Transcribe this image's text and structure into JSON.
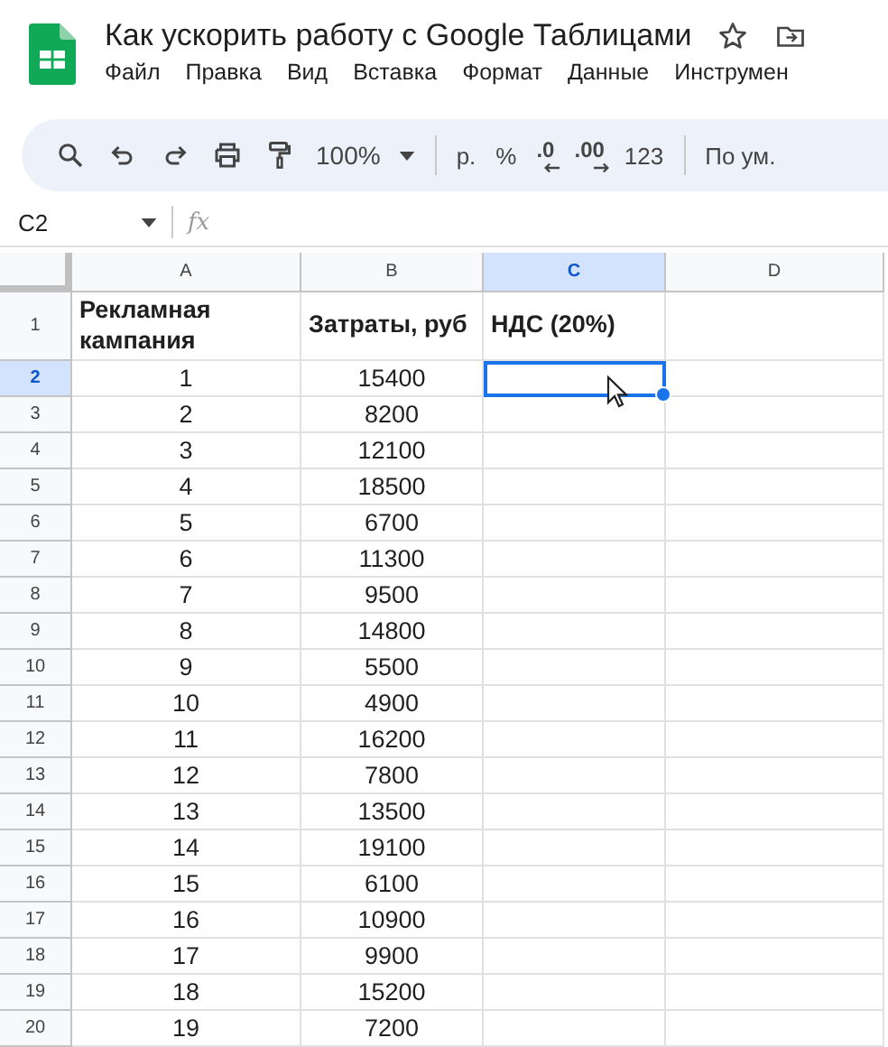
{
  "document": {
    "title": "Как ускорить работу с Google Таблицами",
    "starred": false
  },
  "menu": [
    "Файл",
    "Правка",
    "Вид",
    "Вставка",
    "Формат",
    "Данные",
    "Инструмен"
  ],
  "toolbar": [
    {
      "kind": "search"
    },
    {
      "kind": "undo"
    },
    {
      "kind": "redo"
    },
    {
      "kind": "print"
    },
    {
      "kind": "paint-format"
    },
    {
      "kind": "dropdown",
      "label": "100%"
    },
    {
      "kind": "separator"
    },
    {
      "kind": "text",
      "label": "р."
    },
    {
      "kind": "text",
      "label": "%"
    },
    {
      "kind": "decimal-less",
      "label": ".0"
    },
    {
      "kind": "decimal-more",
      "label": ".00"
    },
    {
      "kind": "text",
      "label": "123"
    },
    {
      "kind": "separator"
    },
    {
      "kind": "text",
      "label": "По ум."
    }
  ],
  "formula_bar": {
    "cell_ref": "C2",
    "fx_label": "fx"
  },
  "columns": [
    {
      "label": "A",
      "selected": false
    },
    {
      "label": "B",
      "selected": false
    },
    {
      "label": "C",
      "selected": true
    },
    {
      "label": "D",
      "selected": false
    }
  ],
  "rows": [
    {
      "number": "1",
      "selected": false,
      "header": true,
      "a": "Рекламная кампания",
      "b": "Затраты, руб",
      "c": "НДС (20%)"
    },
    {
      "number": "2",
      "selected": true,
      "a": "1",
      "b": "15400"
    },
    {
      "number": "3",
      "selected": false,
      "a": "2",
      "b": "8200"
    },
    {
      "number": "4",
      "selected": false,
      "a": "3",
      "b": "12100"
    },
    {
      "number": "5",
      "selected": false,
      "a": "4",
      "b": "18500"
    },
    {
      "number": "6",
      "selected": false,
      "a": "5",
      "b": "6700"
    },
    {
      "number": "7",
      "selected": false,
      "a": "6",
      "b": "11300"
    },
    {
      "number": "8",
      "selected": false,
      "a": "7",
      "b": "9500"
    },
    {
      "number": "9",
      "selected": false,
      "a": "8",
      "b": "14800"
    },
    {
      "number": "10",
      "selected": false,
      "a": "9",
      "b": "5500"
    },
    {
      "number": "11",
      "selected": false,
      "a": "10",
      "b": "4900"
    },
    {
      "number": "12",
      "selected": false,
      "a": "11",
      "b": "16200"
    },
    {
      "number": "13",
      "selected": false,
      "a": "12",
      "b": "7800"
    },
    {
      "number": "14",
      "selected": false,
      "a": "13",
      "b": "13500"
    },
    {
      "number": "15",
      "selected": false,
      "a": "14",
      "b": "19100"
    },
    {
      "number": "16",
      "selected": false,
      "a": "15",
      "b": "6100"
    },
    {
      "number": "17",
      "selected": false,
      "a": "16",
      "b": "10900"
    },
    {
      "number": "18",
      "selected": false,
      "a": "17",
      "b": "9900"
    },
    {
      "number": "19",
      "selected": false,
      "a": "18",
      "b": "15200"
    },
    {
      "number": "20",
      "selected": false,
      "a": "19",
      "b": "7200"
    }
  ]
}
